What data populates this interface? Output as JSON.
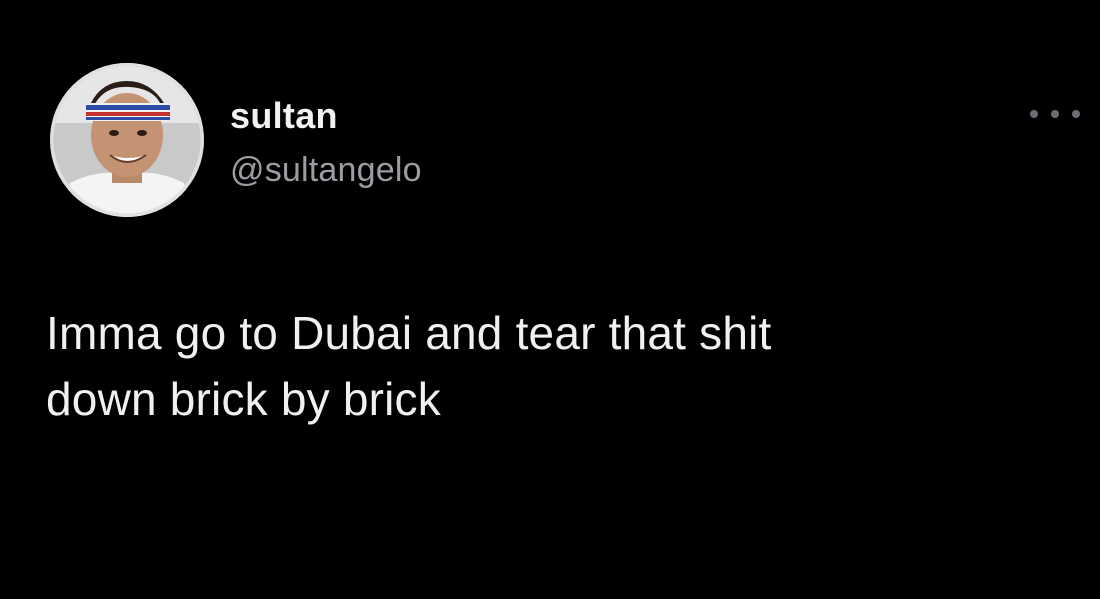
{
  "tweet": {
    "author": {
      "display_name": "sultan",
      "handle": "@sultangelo",
      "avatar_icon": "profile-photo"
    },
    "more_icon": "more-horizontal-icon",
    "text_lines": [
      "Imma go to Dubai and tear that shit",
      "down brick by brick"
    ]
  },
  "colors": {
    "background": "#000000",
    "display_name": "#f2f2f2",
    "handle": "#9a9ea3",
    "text": "#f0f0f0",
    "more_dots": "#6b6f75"
  }
}
